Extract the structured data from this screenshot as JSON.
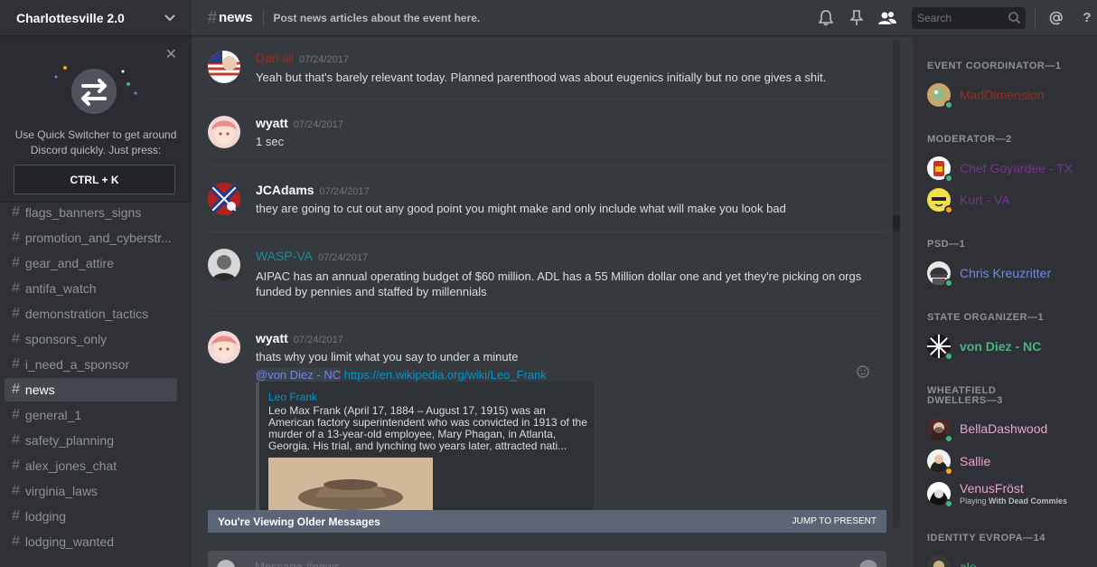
{
  "guild": {
    "name": "Charlottesville 2.0"
  },
  "quick_switcher": {
    "text": "Use Quick Switcher to get around Discord quickly. Just press:",
    "shortcut": "CTRL + K"
  },
  "channels": [
    {
      "name": "flags_banners_signs"
    },
    {
      "name": "promotion_and_cyberstr..."
    },
    {
      "name": "gear_and_attire"
    },
    {
      "name": "antifa_watch"
    },
    {
      "name": "demonstration_tactics"
    },
    {
      "name": "sponsors_only"
    },
    {
      "name": "i_need_a_sponsor"
    },
    {
      "name": "news"
    },
    {
      "name": "general_1"
    },
    {
      "name": "safety_planning"
    },
    {
      "name": "alex_jones_chat"
    },
    {
      "name": "virginia_laws"
    },
    {
      "name": "lodging"
    },
    {
      "name": "lodging_wanted"
    }
  ],
  "header": {
    "channel": "news",
    "topic": "Post news articles about the event here.",
    "search_placeholder": "Search"
  },
  "messages": [
    {
      "author": "Dan iiii",
      "color": "#992d22",
      "time": "07/24/2017",
      "text": "Yeah but that's barely relevant today. Planned parenthood was about eugenics initially but no one gives a shit."
    },
    {
      "author": "wyatt",
      "color": "#ffffff",
      "time": "07/24/2017",
      "text": "1 sec"
    },
    {
      "author": "JCAdams",
      "color": "#ffffff",
      "time": "07/24/2017",
      "text": "they are going to cut out any good point you might make and only include what will make you look bad"
    },
    {
      "author": "WASP-VA",
      "color": "#1f8b99",
      "time": "07/24/2017",
      "text": "AIPAC has an annual operating budget of $60 million. ADL has a 55 Million dollar one and yet they're picking on orgs funded by pennies and staffed by millennials"
    },
    {
      "author": "wyatt",
      "color": "#ffffff",
      "time": "07/24/2017",
      "text": "thats why you limit what you say to under a minute",
      "mention": "@von Diez - NC",
      "link": "https://en.wikipedia.org/wiki/Leo_Frank",
      "embed": {
        "title": "Leo Frank",
        "description": "Leo Max Frank (April 17, 1884 – August 17, 1915) was an American factory superintendent who was convicted in 1913 of the murder of a 13-year-old employee, Mary Phagan, in Atlanta, Georgia. His trial, and lynching two years later, attracted nati..."
      }
    }
  ],
  "older_bar": {
    "text": "You're Viewing Older Messages",
    "action": "JUMP TO PRESENT"
  },
  "composer": {
    "placeholder": "Message #news"
  },
  "member_groups": [
    {
      "title": "EVENT COORDINATOR—1",
      "members": [
        {
          "name": "MadDimension",
          "color": "#992d22",
          "status": "online"
        }
      ]
    },
    {
      "title": "MODERATOR—2",
      "members": [
        {
          "name": "Chef Goyardee - TX",
          "color": "#71368a",
          "status": "online"
        },
        {
          "name": "Kurt - VA",
          "color": "#71368a",
          "status": "idle"
        }
      ]
    },
    {
      "title": "PSD—1",
      "members": [
        {
          "name": "Chris Kreuzritter",
          "color": "#7289da",
          "status": "online"
        }
      ]
    },
    {
      "title": "STATE ORGANIZER—1",
      "members": [
        {
          "name": "von Diez - NC",
          "color": "#43b581",
          "status": "online"
        }
      ]
    },
    {
      "title": "WHEATFIELD DWELLERS—3",
      "members": [
        {
          "name": "BellaDashwood",
          "color": "#e8a6cf",
          "status": "online"
        },
        {
          "name": "Sallie",
          "color": "#e8a6cf",
          "status": "idle"
        },
        {
          "name": "VenusFröst",
          "color": "#e8a6cf",
          "status": "online",
          "game_prefix": "Playing",
          "game": "With Dead Commies"
        }
      ]
    },
    {
      "title": "IDENTITY EVROPA—14",
      "members": [
        {
          "name": "ale",
          "color": "#43b581",
          "status": "online"
        }
      ]
    }
  ],
  "colors": {
    "online": "#43b581",
    "idle": "#faa61a",
    "link": "#0096cf",
    "mention": "#7289da"
  }
}
